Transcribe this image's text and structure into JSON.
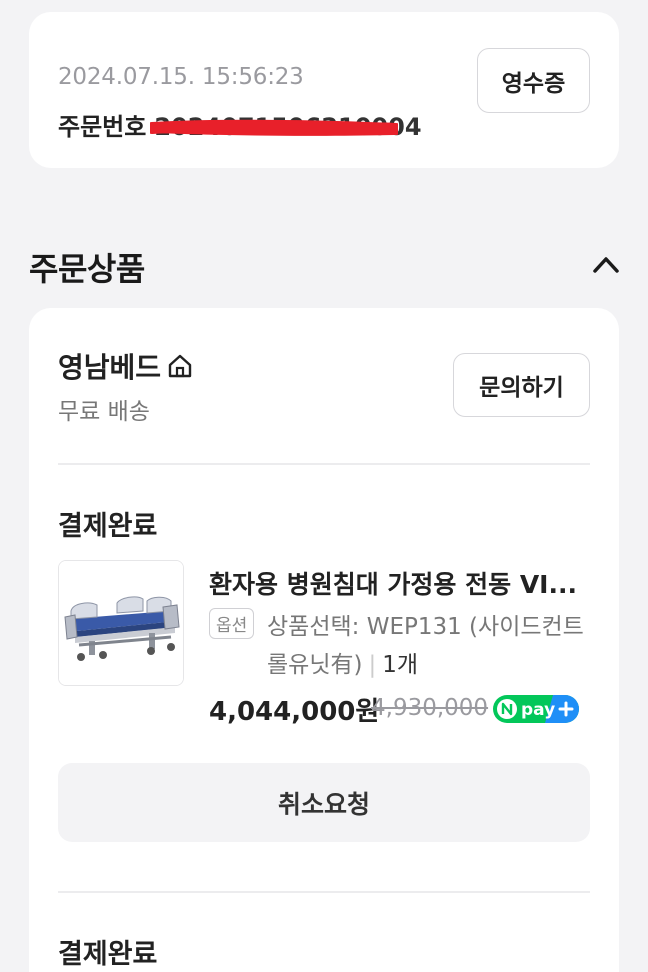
{
  "order": {
    "datetime": "2024.07.15. 15:56:23",
    "number_label": "주문번호",
    "number_value": "2024071506210004",
    "receipt_button": "영수증"
  },
  "section": {
    "title": "주문상품"
  },
  "store": {
    "name": "영남베드",
    "shipping": "무료 배송",
    "inquiry_button": "문의하기"
  },
  "items": [
    {
      "status": "결제완료",
      "product_name": "환자용 병원침대 가정용 전동 VI...",
      "option_tag": "옵션",
      "option_text": "상품선택: WEP131 (사이드컨트롤유닛有)",
      "quantity": "1개",
      "price": "4,044,000원",
      "original_price": "4,930,000",
      "cancel_button": "취소요청"
    },
    {
      "status": "결제완료"
    }
  ],
  "colors": {
    "background": "#f3f3f5",
    "redaction": "#e8202a",
    "npay_green": "#03c75a",
    "npay_blue": "#1f8ff7"
  },
  "icons": [
    "home-icon",
    "chevron-up-icon",
    "npay-plus-icon"
  ]
}
